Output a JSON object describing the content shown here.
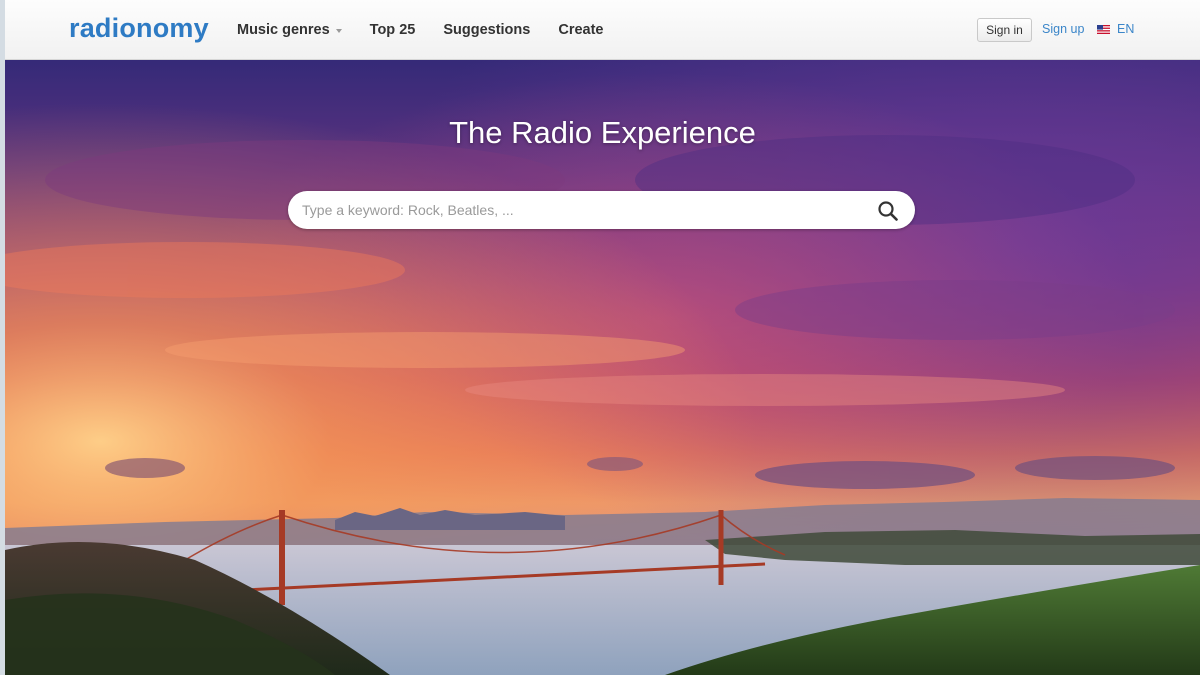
{
  "header": {
    "logo": "radionomy",
    "nav": [
      {
        "label": "Music genres",
        "has_dropdown": true
      },
      {
        "label": "Top 25"
      },
      {
        "label": "Suggestions"
      },
      {
        "label": "Create"
      }
    ],
    "signin_label": "Sign in",
    "signup_label": "Sign up",
    "language": {
      "label": "EN",
      "icon": "us-flag-icon"
    }
  },
  "hero": {
    "title": "The Radio Experience",
    "background": "golden-gate-bridge-sunset-photo",
    "search": {
      "placeholder": "Type a keyword: Rock, Beatles, ...",
      "value": "",
      "icon": "search-icon"
    }
  },
  "colors": {
    "brand": "#2e7bc4",
    "link": "#3b86c9",
    "nav_text": "#333333"
  }
}
